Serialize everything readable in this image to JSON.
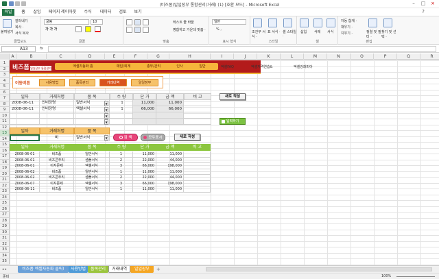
{
  "window": {
    "title": "(비즈폼)일일장부 통합관리(거래) (1) [호환 모드] - Microsoft Excel"
  },
  "ribbon_tabs": [
    "파일",
    "홈",
    "삽입",
    "페이지 레이아웃",
    "수식",
    "데이터",
    "검토",
    "보기"
  ],
  "ribbon": {
    "clipboard": {
      "label": "클립보드",
      "paste": "붙여넣기",
      "cut": "잘라내기",
      "copy": "복사 ·",
      "format": "서식 복사"
    },
    "font": {
      "label": "글꼴",
      "name": "굴림",
      "size": "10"
    },
    "align": {
      "label": "맞춤",
      "wrap": "텍스트 줄 바꿈",
      "merge": "병합하고 가운데 맞춤 ·"
    },
    "number": {
      "label": "표시 형식",
      "format": "일반",
      "symbols": "% ,"
    },
    "styles": {
      "label": "스타일",
      "cond": "조건부 서식 ·",
      "table": "표 서식 ·",
      "cell": "셀 스타일 ·"
    },
    "cells": {
      "label": "셀",
      "insert": "삽입",
      "delete": "삭제",
      "format": "서식"
    },
    "edit": {
      "label": "편집",
      "autosum": "자동 합계 ·",
      "fill": "채우기 ·",
      "clear": "지우기 ·",
      "sort": "정렬 및 필터 ·",
      "find": "찾기 및 선택 ·"
    }
  },
  "formula": {
    "namebox": "A13",
    "fx": "fx",
    "value": ""
  },
  "columns": [
    "A",
    "B",
    "C",
    "D",
    "E",
    "F",
    "G",
    "H",
    "I",
    "J",
    "K",
    "L",
    "M",
    "N",
    "O",
    "P",
    "Q",
    "R",
    "S",
    "T"
  ],
  "rows": [
    "1",
    "2",
    "3",
    "4",
    "5",
    "6",
    "7",
    "8",
    "9",
    "10",
    "11",
    "12",
    "13",
    "14",
    "15",
    "16",
    "17",
    "18",
    "19",
    "20",
    "21",
    "22",
    "23",
    "24",
    "25",
    "26",
    "27",
    "28",
    "29",
    "30",
    "31",
    "32",
    "33",
    "34",
    "35"
  ],
  "banner": {
    "logo": "비즈폼",
    "logo_sub": "일일장부 통합관리",
    "menu": [
      "엑셀자동화 홈",
      "매입/회계",
      "총무/관리",
      "인사",
      "일반"
    ],
    "links": [
      "엑셀FAQ",
      "엑셀자격연습&",
      "엑셀강좌피아"
    ]
  },
  "subnav": {
    "title": "이동버튼",
    "buttons": [
      "사용방법",
      "품목관리",
      "거래내역",
      "일일장부"
    ]
  },
  "entry": {
    "headers": [
      "일자",
      "거래처명",
      "품 목",
      "수 량",
      "단 가",
      "금 액",
      "비 고"
    ],
    "rows": [
      {
        "date": "2008-06-11",
        "client": "인비당명",
        "item": "일반서식",
        "qty": "1",
        "price": "11,000",
        "amount": "11,000",
        "note": ""
      },
      {
        "date": "2008-06-11",
        "client": "인비당명",
        "item": "엑셀서식",
        "qty": "1",
        "price": "66,000",
        "amount": "66,000",
        "note": ""
      }
    ],
    "new_button": "새로 작성",
    "input_button": "입력하기"
  },
  "search": {
    "headers": [
      "일자",
      "거래처명",
      "품 목"
    ],
    "client": "비",
    "item": "일반서식",
    "search_button": "검 색",
    "all_button": "모두표시",
    "new_button": "새로 작성"
  },
  "results": {
    "headers": [
      "일자",
      "거래처명",
      "품 목",
      "수 량",
      "단 가",
      "금 액",
      "비 고"
    ],
    "rows": [
      {
        "date": "2008-06-01",
        "client": "비즈폼",
        "item": "일반서식",
        "qty": "1",
        "price": "11,000",
        "amount": "11,000"
      },
      {
        "date": "2008-06-01",
        "client": "비즈콘주리",
        "item": "샘플서식",
        "qty": "2",
        "price": "22,000",
        "amount": "44,000"
      },
      {
        "date": "2008-06-01",
        "client": "이지문제",
        "item": "엑셀서식",
        "qty": "3",
        "price": "66,000",
        "amount": "198,000"
      },
      {
        "date": "2008-06-02",
        "client": "비즈폼",
        "item": "일반서식",
        "qty": "1",
        "price": "11,000",
        "amount": "11,000"
      },
      {
        "date": "2008-06-02",
        "client": "비즈콘주리",
        "item": "샘플서식",
        "qty": "2",
        "price": "22,000",
        "amount": "44,000"
      },
      {
        "date": "2008-06-07",
        "client": "이지문제",
        "item": "엑셀서식",
        "qty": "3",
        "price": "66,000",
        "amount": "198,000"
      },
      {
        "date": "2008-06-11",
        "client": "비즈폼",
        "item": "일반서식",
        "qty": "1",
        "price": "11,000",
        "amount": "11,000"
      }
    ]
  },
  "sheet_tabs": [
    "비즈폼 엑셀자동화 클릭!",
    "사용방법",
    "품목관리",
    "거래내역",
    "일일장부"
  ],
  "status": {
    "left": "준비",
    "zoom": "100%"
  },
  "colors": {
    "excel_green": "#217346",
    "banner_red": "#b31b1b",
    "menu_orange": "#f6b53b",
    "result_green": "#8cc63e"
  }
}
